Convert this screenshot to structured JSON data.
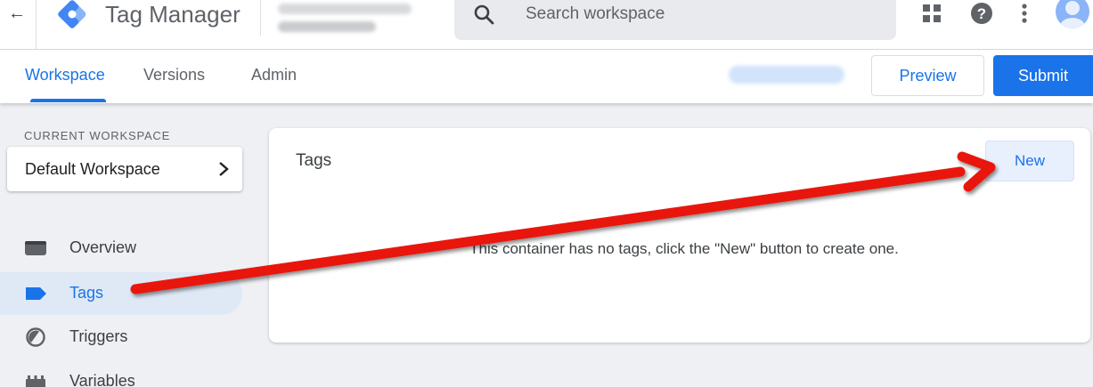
{
  "app": {
    "title": "Tag Manager",
    "back_icon": "back-arrow-icon"
  },
  "search": {
    "placeholder": "Search workspace"
  },
  "tabs": [
    {
      "label": "Workspace",
      "active": true
    },
    {
      "label": "Versions",
      "active": false
    },
    {
      "label": "Admin",
      "active": false
    }
  ],
  "actions": {
    "preview": "Preview",
    "submit": "Submit"
  },
  "sidebar": {
    "current_workspace_label": "CURRENT WORKSPACE",
    "workspace_name": "Default Workspace",
    "items": [
      {
        "label": "Overview",
        "icon": "overview-icon",
        "selected": false
      },
      {
        "label": "Tags",
        "icon": "tag-icon",
        "selected": true
      },
      {
        "label": "Triggers",
        "icon": "trigger-icon",
        "selected": false
      },
      {
        "label": "Variables",
        "icon": "variables-icon",
        "selected": false
      }
    ]
  },
  "main": {
    "title": "Tags",
    "new_button": "New",
    "empty_message": "This container has no tags, click the \"New\" button to create one."
  },
  "colors": {
    "accent": "#1a73e8",
    "selected_bg": "#dfe9f6",
    "annotation_arrow": "#e8140c"
  }
}
